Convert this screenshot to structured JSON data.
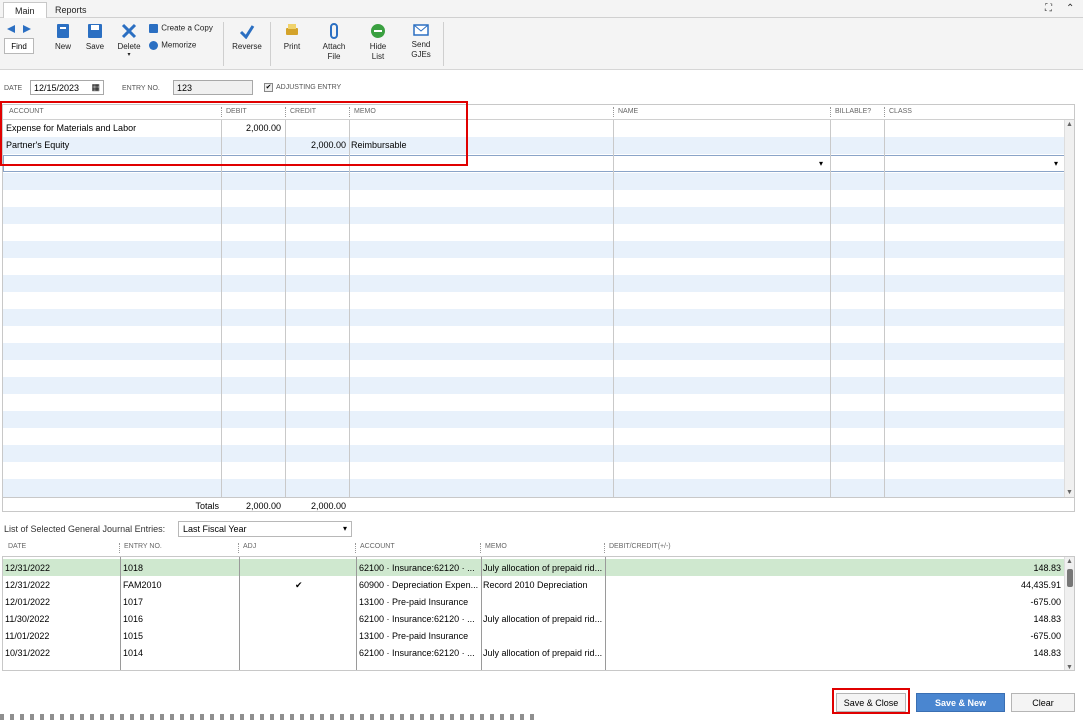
{
  "tabs": [
    "Main",
    "Reports"
  ],
  "toolbar": {
    "find": "Find",
    "new": "New",
    "save": "Save",
    "delete": "Delete",
    "create_copy": "Create a Copy",
    "memorize": "Memorize",
    "reverse": "Reverse",
    "print": "Print",
    "attach_file": "Attach File",
    "hide_list": "Hide List",
    "send_gjes": "Send GJEs"
  },
  "header": {
    "date_label": "DATE",
    "date_value": "12/15/2023",
    "entry_no_label": "ENTRY NO.",
    "entry_no_value": "123",
    "adjusting_label": "ADJUSTING ENTRY"
  },
  "grid": {
    "columns": [
      "ACCOUNT",
      "DEBIT",
      "CREDIT",
      "MEMO",
      "NAME",
      "BILLABLE?",
      "CLASS"
    ],
    "rows": [
      {
        "account": "Expense for Materials and Labor",
        "debit": "2,000.00",
        "credit": "",
        "memo": ""
      },
      {
        "account": "Partner's Equity",
        "debit": "",
        "credit": "2,000.00",
        "memo": "Reimbursable"
      }
    ],
    "totals_label": "Totals",
    "total_debit": "2,000.00",
    "total_credit": "2,000.00"
  },
  "list": {
    "label": "List of Selected General Journal Entries:",
    "filter": "Last Fiscal Year",
    "columns": [
      "DATE",
      "ENTRY NO.",
      "ADJ",
      "ACCOUNT",
      "MEMO",
      "DEBIT/CREDIT(+/-)"
    ],
    "rows": [
      {
        "date": "12/31/2022",
        "entry": "1018",
        "adj": "",
        "account": "62100 · Insurance:62120 · ...",
        "memo": "July allocation of prepaid rid...",
        "amount": "148.83"
      },
      {
        "date": "12/31/2022",
        "entry": "FAM2010",
        "adj": "✔",
        "account": "60900 · Depreciation Expen...",
        "memo": "Record 2010 Depreciation",
        "amount": "44,435.91"
      },
      {
        "date": "12/01/2022",
        "entry": "1017",
        "adj": "",
        "account": "13100 · Pre-paid Insurance",
        "memo": "",
        "amount": "-675.00"
      },
      {
        "date": "11/30/2022",
        "entry": "1016",
        "adj": "",
        "account": "62100 · Insurance:62120 · ...",
        "memo": "July allocation of prepaid rid...",
        "amount": "148.83"
      },
      {
        "date": "11/01/2022",
        "entry": "1015",
        "adj": "",
        "account": "13100 · Pre-paid Insurance",
        "memo": "",
        "amount": "-675.00"
      },
      {
        "date": "10/31/2022",
        "entry": "1014",
        "adj": "",
        "account": "62100 · Insurance:62120 · ...",
        "memo": "July allocation of prepaid rid...",
        "amount": "148.83"
      }
    ]
  },
  "buttons": {
    "save_close": "Save & Close",
    "save_new": "Save & New",
    "clear": "Clear"
  },
  "colors": {
    "accent": "#4a86d0",
    "highlight": "#e00000",
    "stripe": "#e8f1fb",
    "selected_row": "#cfe8cf"
  }
}
